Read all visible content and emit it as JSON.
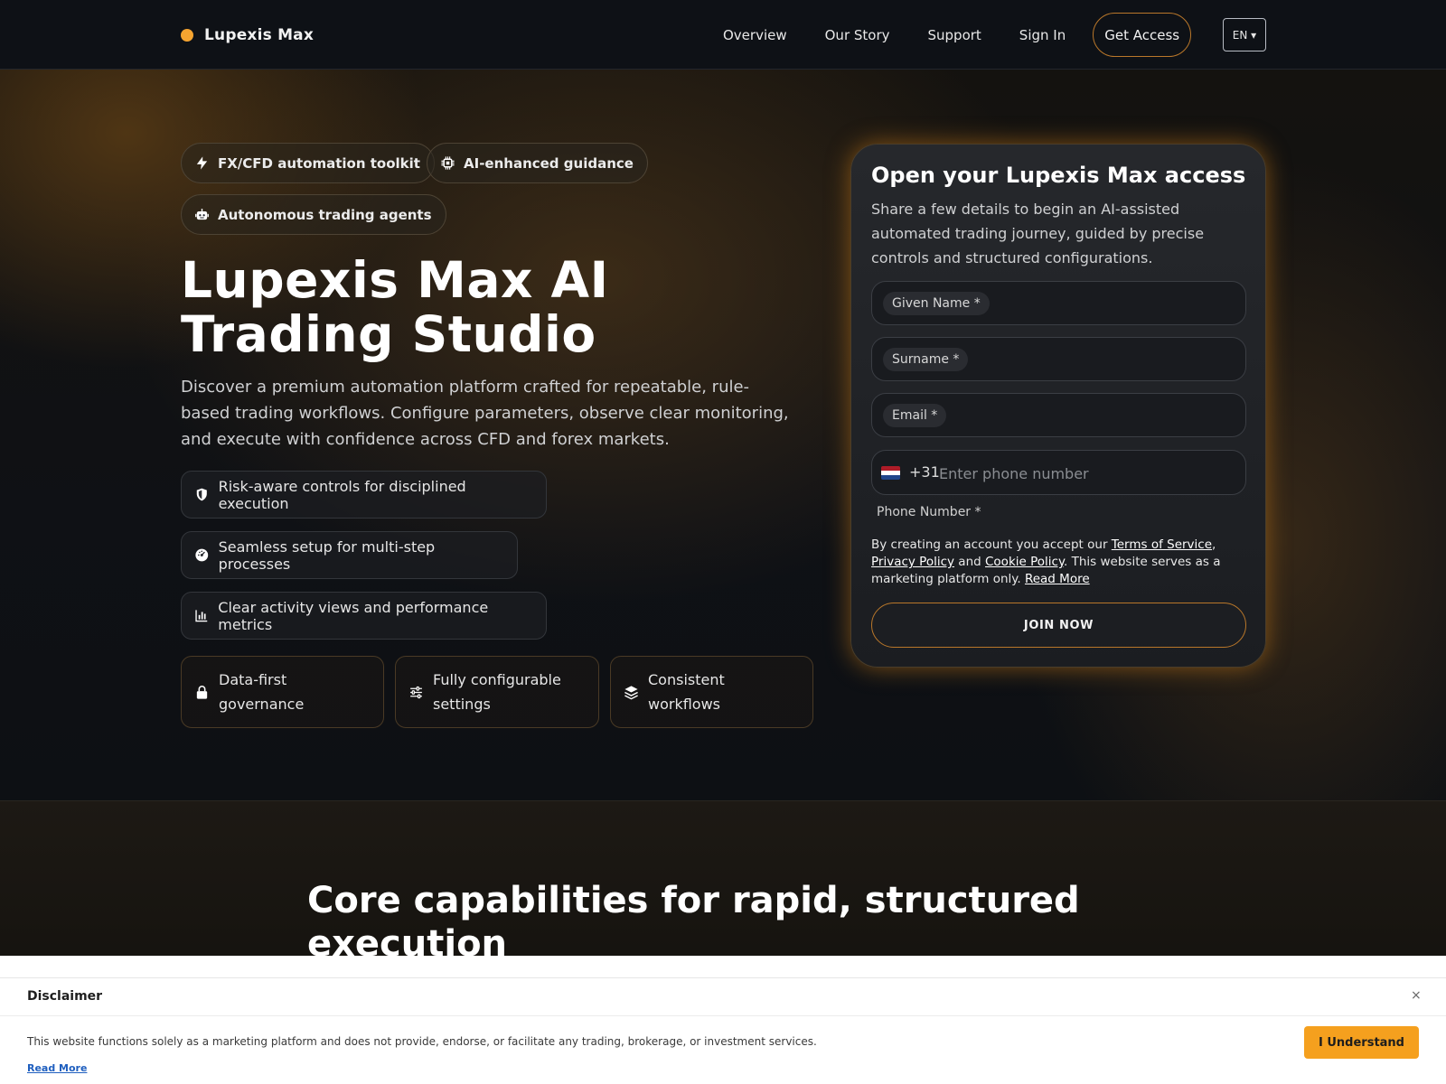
{
  "header": {
    "brand": "Lupexis Max",
    "nav": [
      "Overview",
      "Our Story",
      "Support",
      "Sign In"
    ],
    "cta": "Get Access",
    "language": "EN ▾"
  },
  "hero": {
    "pills": [
      {
        "label": "FX/CFD automation toolkit",
        "icon": "bolt-icon"
      },
      {
        "label": "AI-enhanced guidance",
        "icon": "chip-icon"
      },
      {
        "label": "Autonomous trading agents",
        "icon": "robot-icon"
      }
    ],
    "title": "Lupexis Max AI Trading Studio",
    "description": "Discover a premium automation platform crafted for repeatable, rule-based trading workflows. Configure parameters, observe clear monitoring, and execute with confidence across CFD and forex markets.",
    "features": [
      {
        "label": "Risk-aware controls for disciplined execution",
        "icon": "shield-icon"
      },
      {
        "label": "Seamless setup for multi-step processes",
        "icon": "gauge-icon"
      },
      {
        "label": "Clear activity views and performance metrics",
        "icon": "bar-chart-icon"
      }
    ],
    "tiles": [
      {
        "label": "Data-first governance",
        "icon": "lock-icon"
      },
      {
        "label": "Fully configurable settings",
        "icon": "sliders-icon"
      },
      {
        "label": "Consistent workflows",
        "icon": "layers-icon"
      }
    ]
  },
  "form": {
    "title": "Open your Lupexis Max access",
    "subtitle": "Share a few details to begin an AI-assisted automated trading journey, guided by precise controls and structured configurations.",
    "given_name_label": "Given Name *",
    "surname_label": "Surname *",
    "email_label": "Email *",
    "dial_code": "+31",
    "phone_placeholder": "Enter phone number",
    "phone_label": "Phone Number *",
    "terms_prefix": "By creating an account you accept our ",
    "terms_link": "Terms of Service",
    "terms_comma": ",",
    "privacy_link": "Privacy Policy",
    "terms_and": " and ",
    "cookie_link": "Cookie Policy",
    "terms_suffix": ". This website serves as a marketing platform only. ",
    "read_more": "Read More",
    "submit": "JOIN NOW"
  },
  "section2": {
    "title": "Core capabilities for rapid, structured execution"
  },
  "disclaimer": {
    "title": "Disclaimer",
    "close": "×",
    "text": "This website functions solely as a marketing platform and does not provide, endorse, or facilitate any trading, brokerage, or investment services.",
    "read_more": "Read More",
    "button": "I Understand"
  },
  "colors": {
    "accent": "#f5a430",
    "accent_border": "#b9772a",
    "disclaimer_button": "#f5a01e",
    "flag": [
      "#ae1c28",
      "#ffffff",
      "#21468b"
    ]
  }
}
